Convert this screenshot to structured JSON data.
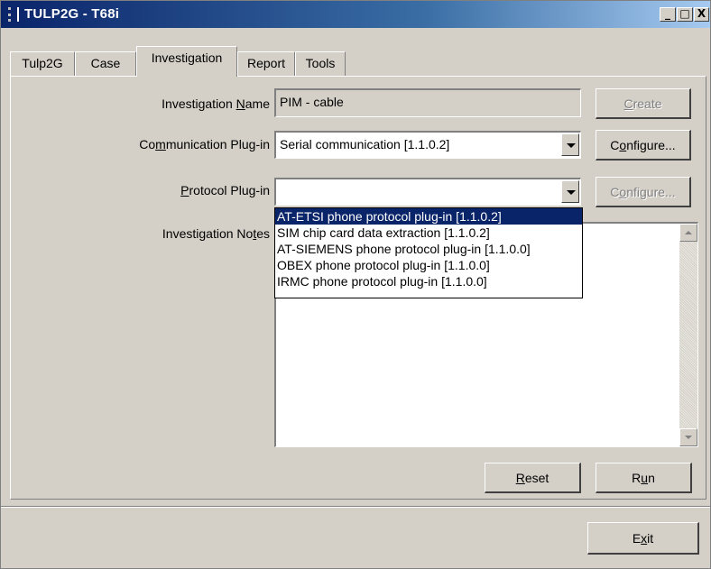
{
  "window": {
    "title": "TULP2G - T68i",
    "minimize_glyph": "_",
    "maximize_glyph": "□",
    "close_glyph": "X"
  },
  "tabs": [
    {
      "label": "Tulp2G"
    },
    {
      "label": "Case"
    },
    {
      "label": "Investigation",
      "active": true
    },
    {
      "label": "Report"
    },
    {
      "label": "Tools"
    }
  ],
  "form": {
    "investigation_name": {
      "label_pre": "Investigation ",
      "label_hot": "N",
      "label_post": "ame",
      "value": "PIM - cable"
    },
    "communication_plugin": {
      "label_pre": "Co",
      "label_hot": "m",
      "label_post": "munication Plug-in",
      "value": "Serial communication [1.1.0.2]"
    },
    "protocol_plugin": {
      "label_pre": "",
      "label_hot": "P",
      "label_post": "rotocol Plug-in",
      "value": "",
      "options": [
        "AT-ETSI phone protocol plug-in [1.1.0.2]",
        "SIM chip card data extraction [1.1.0.2]",
        "AT-SIEMENS phone protocol plug-in [1.1.0.0]",
        "OBEX phone protocol plug-in [1.1.0.0]",
        "IRMC phone protocol plug-in [1.1.0.0]"
      ],
      "highlighted_index": 0
    },
    "investigation_notes": {
      "label_pre": "Investigation No",
      "label_hot": "t",
      "label_post": "es",
      "value": ""
    }
  },
  "buttons": {
    "create": {
      "pre": "",
      "hot": "C",
      "post": "reate",
      "enabled": false
    },
    "configure_comm": {
      "pre": "C",
      "hot": "o",
      "post": "nfigure...",
      "enabled": true
    },
    "configure_proto": {
      "pre": "C",
      "hot": "o",
      "post": "nfigure...",
      "enabled": false
    },
    "reset": {
      "pre": "",
      "hot": "R",
      "post": "eset",
      "enabled": true
    },
    "run": {
      "pre": "R",
      "hot": "u",
      "post": "n",
      "enabled": true
    },
    "exit": {
      "pre": "E",
      "hot": "x",
      "post": "it",
      "enabled": true
    }
  },
  "colors": {
    "titlebar_start": "#0a246a",
    "titlebar_end": "#a6caf0",
    "selection": "#0a246a",
    "face": "#d4d0c8"
  }
}
